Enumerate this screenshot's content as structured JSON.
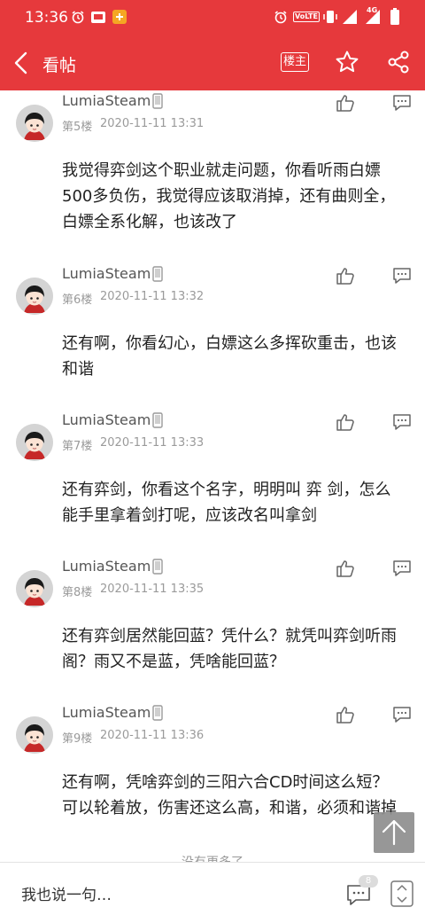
{
  "status_bar": {
    "time": "13:36",
    "volte": "VoLTE",
    "network": "4G"
  },
  "header": {
    "title": "看帖",
    "op_badge": "楼主"
  },
  "posts": [
    {
      "username": "LumiaSteam",
      "floor": "第5楼",
      "time": "2020-11-11 13:31",
      "lines": [
        "我觉得弈剑这个职业就走问题，你看听雨白嫖",
        "500多负伤，我觉得应该取消掉，还有曲则全，",
        "白嫖全系化解，也该改了"
      ]
    },
    {
      "username": "LumiaSteam",
      "floor": "第6楼",
      "time": "2020-11-11 13:32",
      "lines": [
        "还有啊，你看幻心，白嫖这么多挥砍重击，也该",
        "和谐"
      ]
    },
    {
      "username": "LumiaSteam",
      "floor": "第7楼",
      "time": "2020-11-11 13:33",
      "lines": [
        "还有弈剑，你看这个名字，明明叫 弈 剑，怎么",
        "能手里拿着剑打呢，应该改名叫拿剑"
      ]
    },
    {
      "username": "LumiaSteam",
      "floor": "第8楼",
      "time": "2020-11-11 13:35",
      "lines": [
        "还有弈剑居然能回蓝？凭什么？就凭叫弈剑听雨",
        "阁？雨又不是蓝，凭啥能回蓝？"
      ]
    },
    {
      "username": "LumiaSteam",
      "floor": "第9楼",
      "time": "2020-11-11 13:36",
      "lines": [
        "还有啊，凭啥弈剑的三阳六合CD时间这么短？",
        "可以轮着放，伤害还这么高，和谐，必须和谐掉"
      ]
    }
  ],
  "footer_note": "没有更多了",
  "bottom_bar": {
    "reply_placeholder": "我也说一句…",
    "comment_count": "8"
  },
  "colors": {
    "brand_red": "#e6393c",
    "text": "#222222",
    "meta": "#9a9a9a"
  }
}
